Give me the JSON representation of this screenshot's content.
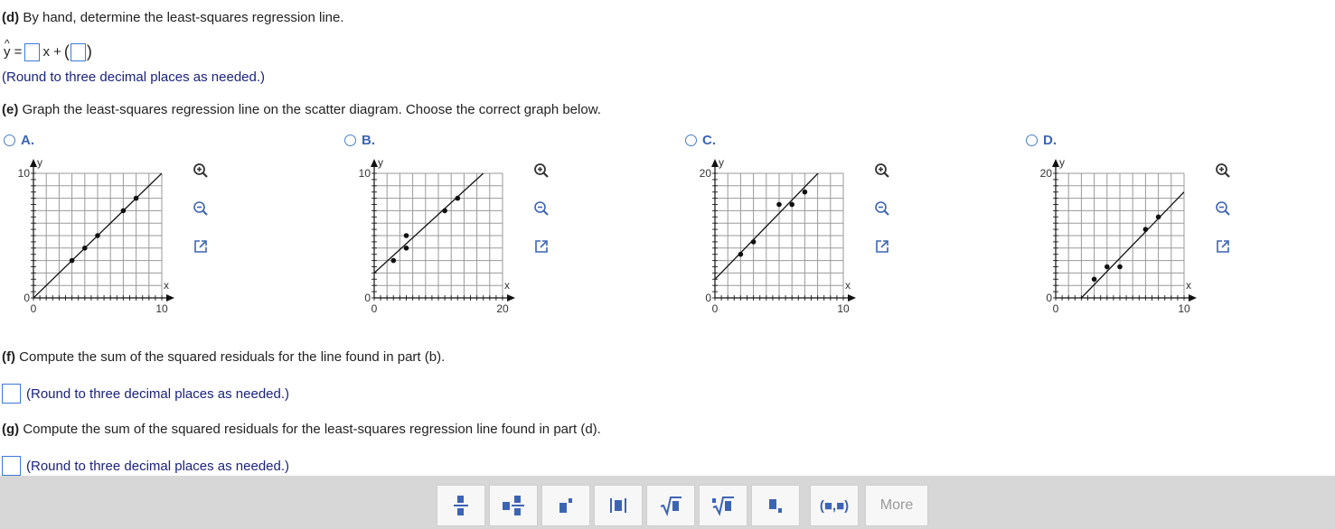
{
  "part_d": {
    "label": "(d)",
    "text": "By hand, determine the least-squares regression line.",
    "equation": {
      "lhs": "y =",
      "mid": "x +",
      "open": "(",
      "close": ")"
    },
    "note": "(Round to three decimal places as needed.)"
  },
  "part_e": {
    "label": "(e)",
    "text": "Graph the least-squares regression line on the scatter diagram. Choose the correct graph below."
  },
  "options": [
    {
      "letter": "A.",
      "y_max_label": "10",
      "x_max_label": "10",
      "y_min_label": "0",
      "x_min_label": "0",
      "x_axis": "x",
      "y_axis": "y",
      "x_max": 10,
      "y_max": 10,
      "points": [
        [
          3,
          3
        ],
        [
          4,
          4
        ],
        [
          5,
          5
        ],
        [
          7,
          7
        ],
        [
          8,
          8
        ]
      ],
      "line": [
        [
          0,
          0
        ],
        [
          10,
          10
        ]
      ]
    },
    {
      "letter": "B.",
      "y_max_label": "10",
      "x_max_label": "20",
      "y_min_label": "0",
      "x_min_label": "0",
      "x_axis": "x",
      "y_axis": "y",
      "x_max": 20,
      "y_max": 10,
      "points": [
        [
          3,
          3
        ],
        [
          5,
          4
        ],
        [
          5,
          5
        ],
        [
          11,
          7
        ],
        [
          13,
          8
        ]
      ],
      "line": [
        [
          0,
          2
        ],
        [
          17,
          10
        ]
      ]
    },
    {
      "letter": "C.",
      "y_max_label": "20",
      "x_max_label": "10",
      "y_min_label": "0",
      "x_min_label": "0",
      "x_axis": "x",
      "y_axis": "y",
      "x_max": 10,
      "y_max": 20,
      "points": [
        [
          2,
          7
        ],
        [
          3,
          9
        ],
        [
          5,
          15
        ],
        [
          6,
          15
        ],
        [
          7,
          17
        ]
      ],
      "line": [
        [
          0,
          3
        ],
        [
          8.5,
          21
        ]
      ]
    },
    {
      "letter": "D.",
      "y_max_label": "20",
      "x_max_label": "10",
      "y_min_label": "0",
      "x_min_label": "0",
      "x_axis": "x",
      "y_axis": "y",
      "x_max": 10,
      "y_max": 20,
      "points": [
        [
          3,
          3
        ],
        [
          4,
          5
        ],
        [
          5,
          5
        ],
        [
          7,
          11
        ],
        [
          8,
          13
        ]
      ],
      "line": [
        [
          2,
          0
        ],
        [
          10,
          17
        ]
      ]
    }
  ],
  "part_f": {
    "label": "(f)",
    "text": "Compute the sum of the squared residuals for the line found in part (b).",
    "note": "(Round to three decimal places as needed.)"
  },
  "part_g": {
    "label": "(g)",
    "text": "Compute the sum of the squared residuals for the least-squares regression line found in part (d).",
    "note": "(Round to three decimal places as needed.)"
  },
  "toolbar": {
    "more_label": "More",
    "ordered_pair_label": "(■,■)"
  },
  "colors": {
    "accent": "#3c64b4",
    "note": "#1a237e",
    "toolbar_bg": "#d7d7d7"
  }
}
